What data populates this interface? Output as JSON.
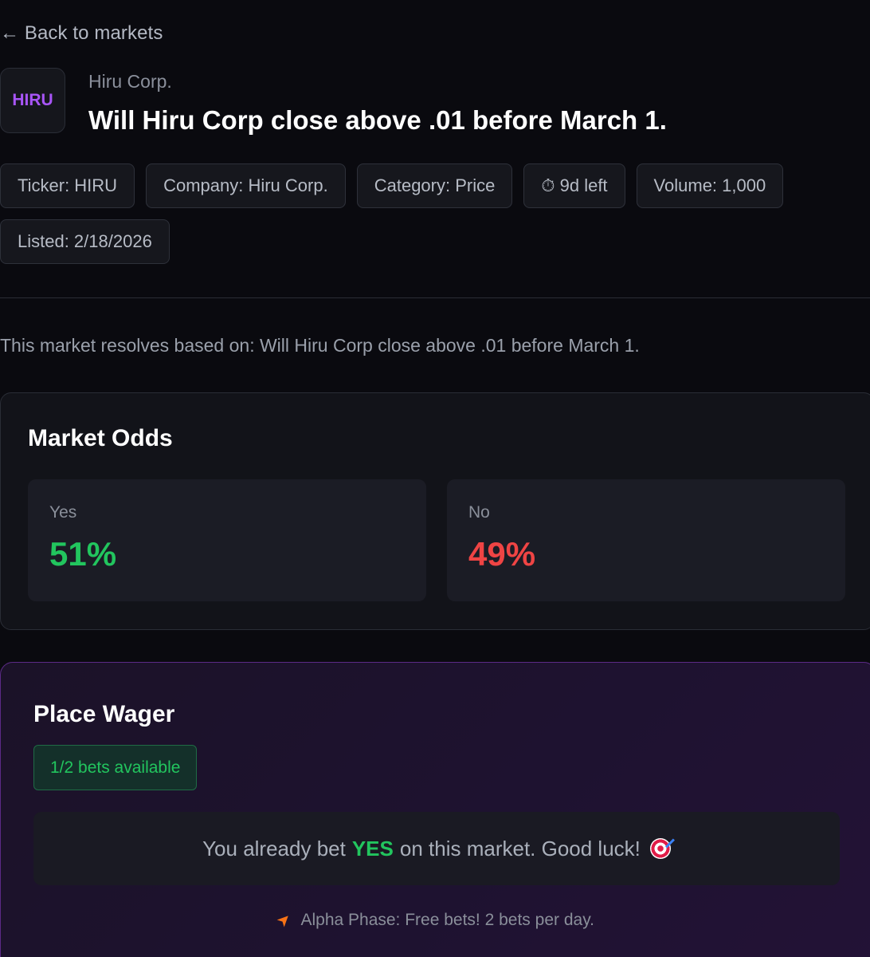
{
  "nav": {
    "back_label": "← Back to markets"
  },
  "market": {
    "logo_text": "HIRU",
    "company": "Hiru Corp.",
    "title": "Will Hiru Corp close above .01 before March 1.",
    "tags": {
      "ticker": "Ticker: HIRU",
      "company": "Company: Hiru Corp.",
      "category": "Category: Price",
      "time_left": "⏱ 9d left",
      "volume": "Volume: 1,000",
      "listed": "Listed: 2/18/2026"
    },
    "description": "This market resolves based on: Will Hiru Corp close above .01 before March 1."
  },
  "odds": {
    "title": "Market Odds",
    "yes_label": "Yes",
    "yes_value": "51%",
    "no_label": "No",
    "no_value": "49%"
  },
  "wager": {
    "title": "Place Wager",
    "bets_available": "1/2 bets available",
    "already_bet_prefix": "You already bet",
    "already_bet_side": "YES",
    "already_bet_suffix": "on this market. Good luck!",
    "alpha_note": "Alpha Phase: Free bets! 2 bets per day."
  },
  "icons": {
    "time_left": "stopwatch-icon",
    "already_bet": "target-icon",
    "alpha_note": "rocket-icon"
  },
  "colors": {
    "background": "#0a0a0f",
    "accent_purple": "#a855f7",
    "yes_green": "#22c55e",
    "no_red": "#ef4444",
    "wager_border": "#5b2a86"
  }
}
